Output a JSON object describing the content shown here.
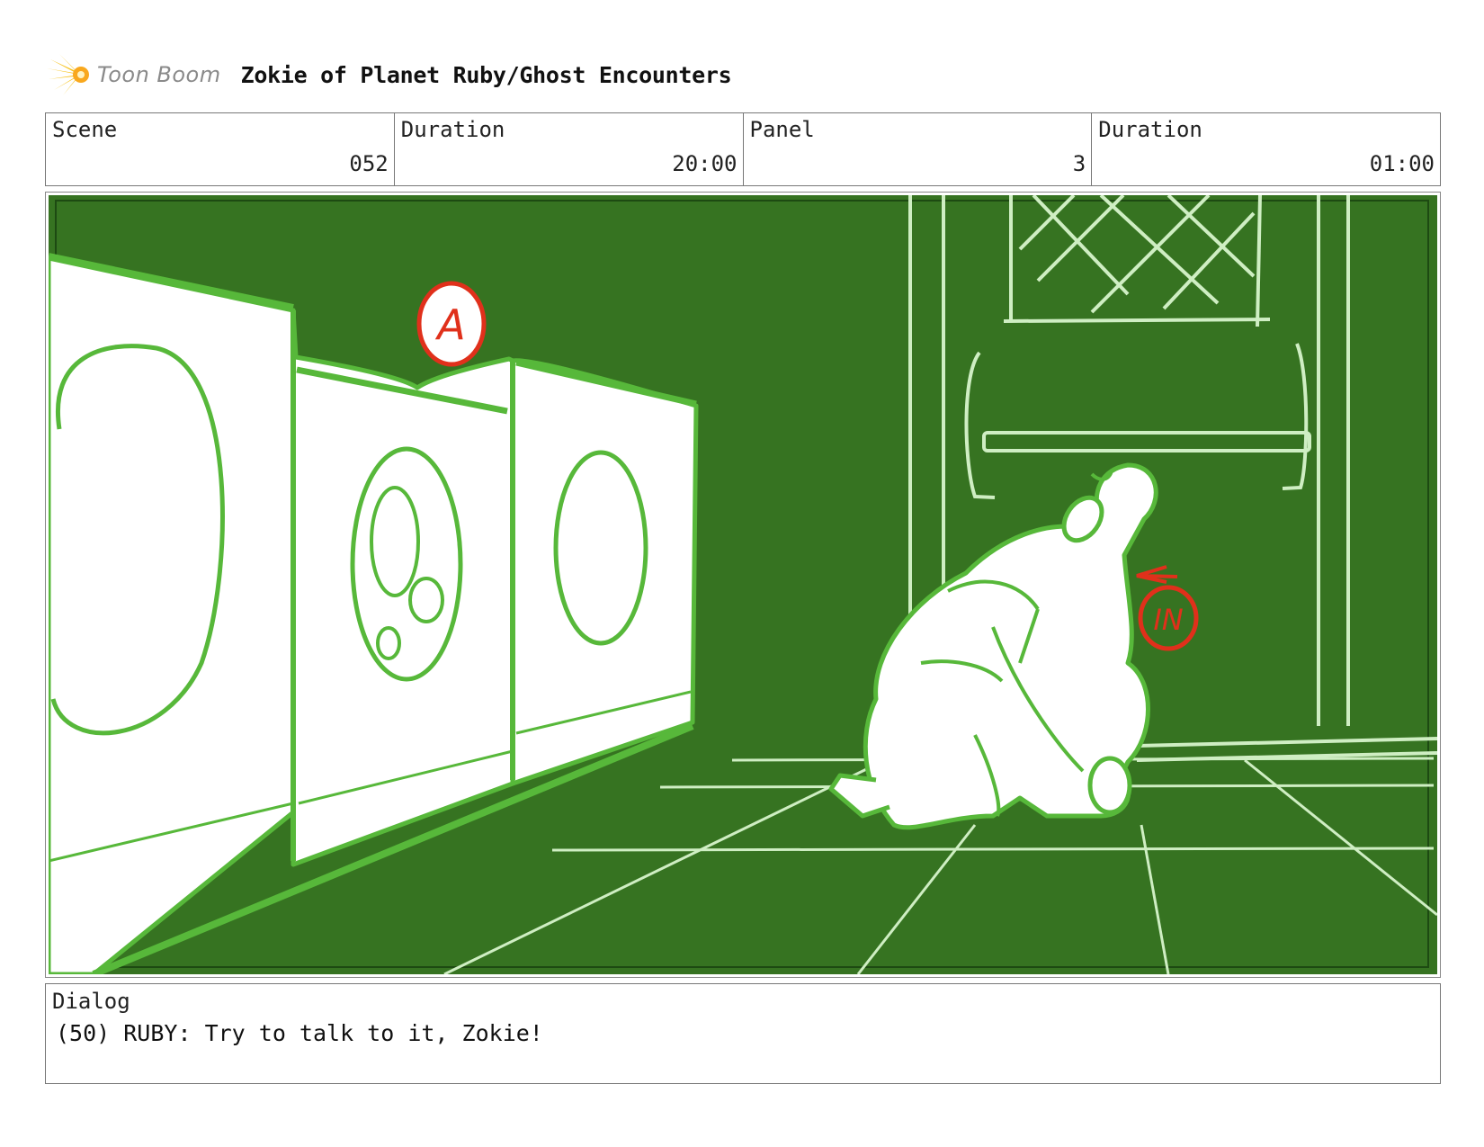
{
  "header": {
    "brand": "Toon Boom",
    "title": "Zokie of Planet Ruby/Ghost Encounters"
  },
  "info": {
    "scene_label": "Scene",
    "scene_value": "052",
    "scene_duration_label": "Duration",
    "scene_duration_value": "20:00",
    "panel_label": "Panel",
    "panel_value": "3",
    "panel_duration_label": "Duration",
    "panel_duration_value": "01:00"
  },
  "panel": {
    "marker_a": "A",
    "marker_in": "IN",
    "colors": {
      "background": "#367321",
      "line_green": "#57b83a",
      "light_line": "#cfeec3",
      "red": "#e0301b"
    }
  },
  "dialog": {
    "label": "Dialog",
    "text": "(50) RUBY: Try to talk to it, Zokie!"
  }
}
